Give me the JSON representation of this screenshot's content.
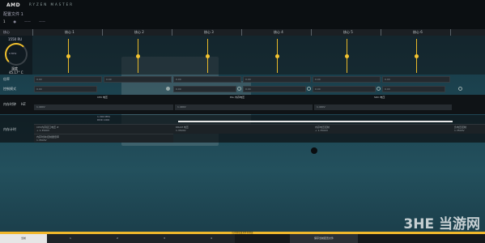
{
  "app": {
    "brand": "AMD",
    "brand_sub": "RYZEN MASTER",
    "page_title": "配置文件 1"
  },
  "tabs": [
    {
      "label": "1"
    },
    {
      "label": "●"
    },
    {
      "label": "——"
    },
    {
      "label": "——"
    }
  ],
  "header": {
    "section_label": "核心",
    "columns": [
      {
        "label": "核心 1"
      },
      {
        "label": "核心 2"
      },
      {
        "label": "核心 3"
      },
      {
        "label": "核心 4"
      },
      {
        "label": "核心 5"
      },
      {
        "label": "核心 6"
      }
    ]
  },
  "gauge": {
    "top_value": "1550 RU",
    "inner_text": "0 MHz",
    "label": "温度",
    "temp": "45.17° C",
    "level": 0.25
  },
  "rows": {
    "multiplier": {
      "label": "倍率",
      "values": [
        "0.00",
        "0.00",
        "0.00",
        "0.00",
        "0.00",
        "0.00"
      ]
    },
    "control": {
      "label": "控制模式",
      "values": [
        "0.00",
        "0.00",
        "0.00",
        "0.00",
        "0.00",
        "0.00"
      ]
    }
  },
  "memory_section": {
    "label": "内存时钟",
    "unit": "HZ",
    "headers": [
      "CPU 电压",
      "PLL 内存电压",
      "SOC 电压"
    ],
    "values": [
      "1.400V",
      "1.400V",
      "1.400V"
    ]
  },
  "timing_section": {
    "label": "内存计时",
    "info_lines": [
      "1,300 MHz",
      "DDR 1000"
    ],
    "fields": [
      {
        "label": "CPU内存接口电压 #",
        "value": "+ 1.3500V"
      },
      {
        "label": "DRAM 电压",
        "value": "1.3500V"
      },
      {
        "label": "内存电压控制",
        "value": "+ 1.3500V"
      },
      {
        "label": "负电压控制",
        "value": "1.3500V"
      },
      {
        "label": "内存时钟/控制器倍率",
        "value": "1.3500V"
      }
    ]
  },
  "bottom": {
    "progress_label": "应用新配置文件并测试",
    "tabs": [
      "当前",
      "1",
      "2",
      "3",
      "4"
    ],
    "right_button": "保存当前配置文件"
  },
  "watermark": "3HE 当游网"
}
